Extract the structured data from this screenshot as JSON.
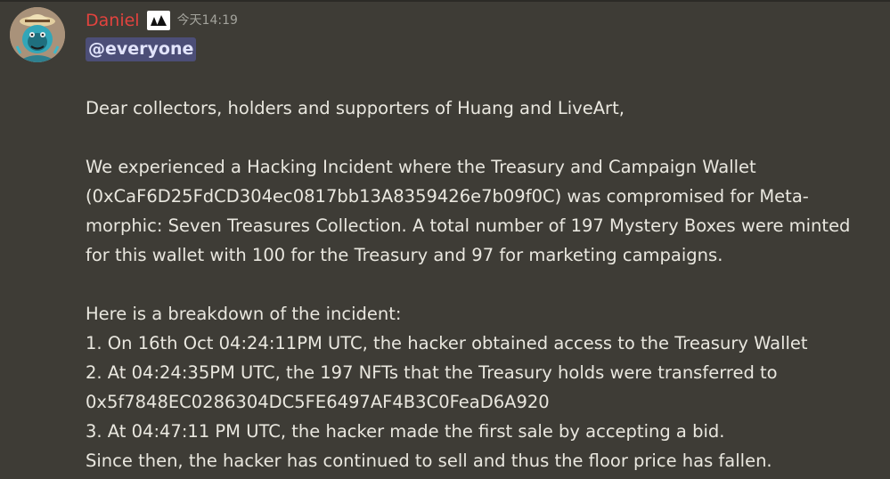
{
  "message": {
    "author": "Daniel",
    "timestamp": "今天14:19",
    "mention": "@everyone",
    "greeting": "Dear collectors, holders and supporters of Huang and LiveArt,",
    "paragraph1": [
      "We experienced a Hacking Incident where the Treasury and Campaign Wallet",
      "(0xCaF6D25FdCD304ec0817bb13A8359426e7b09f0C) was compromised for Meta-",
      "morphic: Seven Treasures Collection. A total number of 197 Mystery Boxes were minted",
      "for this wallet with 100 for the Treasury and 97 for marketing campaigns."
    ],
    "breakdown": [
      "Here is a breakdown of the incident:",
      "1. On 16th Oct 04:24:11PM UTC, the hacker obtained access to the Treasury Wallet",
      "2. At 04:24:35PM UTC, the 197 NFTs that the Treasury holds were transferred to",
      "0x5f7848EC0286304DC5FE6497AF4B3C0FeaD6A920",
      "3. At 04:47:11 PM UTC, the hacker made the first sale by accepting a bid.",
      "Since then, the hacker has continued to sell and thus the floor price has fallen."
    ]
  },
  "icons": {
    "avatar": "avatar-image",
    "badge": "liveart-badge-icon"
  },
  "colors": {
    "background": "#3e3c36",
    "username": "#e2433e",
    "mention_bg": "#4c4e77",
    "text": "#e9e7df",
    "timestamp": "#a3a39c"
  }
}
